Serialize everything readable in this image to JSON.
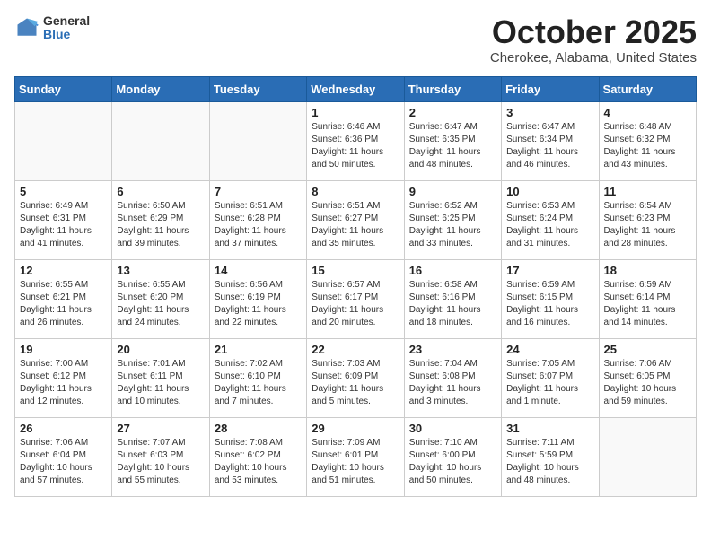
{
  "header": {
    "logo_general": "General",
    "logo_blue": "Blue",
    "month_title": "October 2025",
    "location": "Cherokee, Alabama, United States"
  },
  "weekdays": [
    "Sunday",
    "Monday",
    "Tuesday",
    "Wednesday",
    "Thursday",
    "Friday",
    "Saturday"
  ],
  "weeks": [
    [
      {
        "day": "",
        "info": ""
      },
      {
        "day": "",
        "info": ""
      },
      {
        "day": "",
        "info": ""
      },
      {
        "day": "1",
        "info": "Sunrise: 6:46 AM\nSunset: 6:36 PM\nDaylight: 11 hours\nand 50 minutes."
      },
      {
        "day": "2",
        "info": "Sunrise: 6:47 AM\nSunset: 6:35 PM\nDaylight: 11 hours\nand 48 minutes."
      },
      {
        "day": "3",
        "info": "Sunrise: 6:47 AM\nSunset: 6:34 PM\nDaylight: 11 hours\nand 46 minutes."
      },
      {
        "day": "4",
        "info": "Sunrise: 6:48 AM\nSunset: 6:32 PM\nDaylight: 11 hours\nand 43 minutes."
      }
    ],
    [
      {
        "day": "5",
        "info": "Sunrise: 6:49 AM\nSunset: 6:31 PM\nDaylight: 11 hours\nand 41 minutes."
      },
      {
        "day": "6",
        "info": "Sunrise: 6:50 AM\nSunset: 6:29 PM\nDaylight: 11 hours\nand 39 minutes."
      },
      {
        "day": "7",
        "info": "Sunrise: 6:51 AM\nSunset: 6:28 PM\nDaylight: 11 hours\nand 37 minutes."
      },
      {
        "day": "8",
        "info": "Sunrise: 6:51 AM\nSunset: 6:27 PM\nDaylight: 11 hours\nand 35 minutes."
      },
      {
        "day": "9",
        "info": "Sunrise: 6:52 AM\nSunset: 6:25 PM\nDaylight: 11 hours\nand 33 minutes."
      },
      {
        "day": "10",
        "info": "Sunrise: 6:53 AM\nSunset: 6:24 PM\nDaylight: 11 hours\nand 31 minutes."
      },
      {
        "day": "11",
        "info": "Sunrise: 6:54 AM\nSunset: 6:23 PM\nDaylight: 11 hours\nand 28 minutes."
      }
    ],
    [
      {
        "day": "12",
        "info": "Sunrise: 6:55 AM\nSunset: 6:21 PM\nDaylight: 11 hours\nand 26 minutes."
      },
      {
        "day": "13",
        "info": "Sunrise: 6:55 AM\nSunset: 6:20 PM\nDaylight: 11 hours\nand 24 minutes."
      },
      {
        "day": "14",
        "info": "Sunrise: 6:56 AM\nSunset: 6:19 PM\nDaylight: 11 hours\nand 22 minutes."
      },
      {
        "day": "15",
        "info": "Sunrise: 6:57 AM\nSunset: 6:17 PM\nDaylight: 11 hours\nand 20 minutes."
      },
      {
        "day": "16",
        "info": "Sunrise: 6:58 AM\nSunset: 6:16 PM\nDaylight: 11 hours\nand 18 minutes."
      },
      {
        "day": "17",
        "info": "Sunrise: 6:59 AM\nSunset: 6:15 PM\nDaylight: 11 hours\nand 16 minutes."
      },
      {
        "day": "18",
        "info": "Sunrise: 6:59 AM\nSunset: 6:14 PM\nDaylight: 11 hours\nand 14 minutes."
      }
    ],
    [
      {
        "day": "19",
        "info": "Sunrise: 7:00 AM\nSunset: 6:12 PM\nDaylight: 11 hours\nand 12 minutes."
      },
      {
        "day": "20",
        "info": "Sunrise: 7:01 AM\nSunset: 6:11 PM\nDaylight: 11 hours\nand 10 minutes."
      },
      {
        "day": "21",
        "info": "Sunrise: 7:02 AM\nSunset: 6:10 PM\nDaylight: 11 hours\nand 7 minutes."
      },
      {
        "day": "22",
        "info": "Sunrise: 7:03 AM\nSunset: 6:09 PM\nDaylight: 11 hours\nand 5 minutes."
      },
      {
        "day": "23",
        "info": "Sunrise: 7:04 AM\nSunset: 6:08 PM\nDaylight: 11 hours\nand 3 minutes."
      },
      {
        "day": "24",
        "info": "Sunrise: 7:05 AM\nSunset: 6:07 PM\nDaylight: 11 hours\nand 1 minute."
      },
      {
        "day": "25",
        "info": "Sunrise: 7:06 AM\nSunset: 6:05 PM\nDaylight: 10 hours\nand 59 minutes."
      }
    ],
    [
      {
        "day": "26",
        "info": "Sunrise: 7:06 AM\nSunset: 6:04 PM\nDaylight: 10 hours\nand 57 minutes."
      },
      {
        "day": "27",
        "info": "Sunrise: 7:07 AM\nSunset: 6:03 PM\nDaylight: 10 hours\nand 55 minutes."
      },
      {
        "day": "28",
        "info": "Sunrise: 7:08 AM\nSunset: 6:02 PM\nDaylight: 10 hours\nand 53 minutes."
      },
      {
        "day": "29",
        "info": "Sunrise: 7:09 AM\nSunset: 6:01 PM\nDaylight: 10 hours\nand 51 minutes."
      },
      {
        "day": "30",
        "info": "Sunrise: 7:10 AM\nSunset: 6:00 PM\nDaylight: 10 hours\nand 50 minutes."
      },
      {
        "day": "31",
        "info": "Sunrise: 7:11 AM\nSunset: 5:59 PM\nDaylight: 10 hours\nand 48 minutes."
      },
      {
        "day": "",
        "info": ""
      }
    ]
  ]
}
